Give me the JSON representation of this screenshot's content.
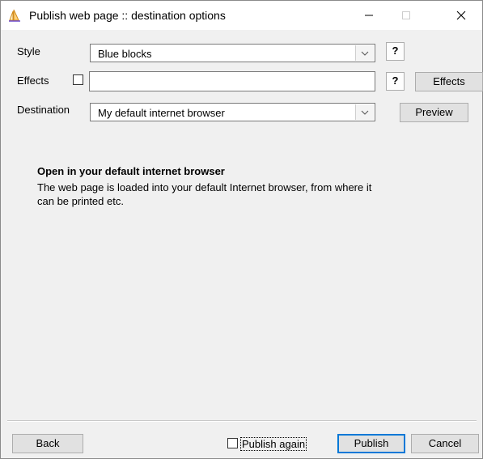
{
  "window": {
    "title": "Publish web page :: destination options",
    "icon": "sail-icon"
  },
  "style_row": {
    "label": "Style",
    "value": "Blue blocks",
    "help_label": "?"
  },
  "effects_row": {
    "label": "Effects",
    "checked": false,
    "value": "",
    "help_label": "?",
    "button_label": "Effects"
  },
  "destination_row": {
    "label": "Destination",
    "value": "My default internet browser",
    "button_label": "Preview"
  },
  "info": {
    "title": "Open in your default internet browser",
    "text": "The web page is loaded into your default Internet browser, from where it can be printed etc."
  },
  "footer": {
    "back_label": "Back",
    "publish_again_label": "Publish again",
    "publish_again_checked": false,
    "publish_label": "Publish",
    "cancel_label": "Cancel"
  }
}
